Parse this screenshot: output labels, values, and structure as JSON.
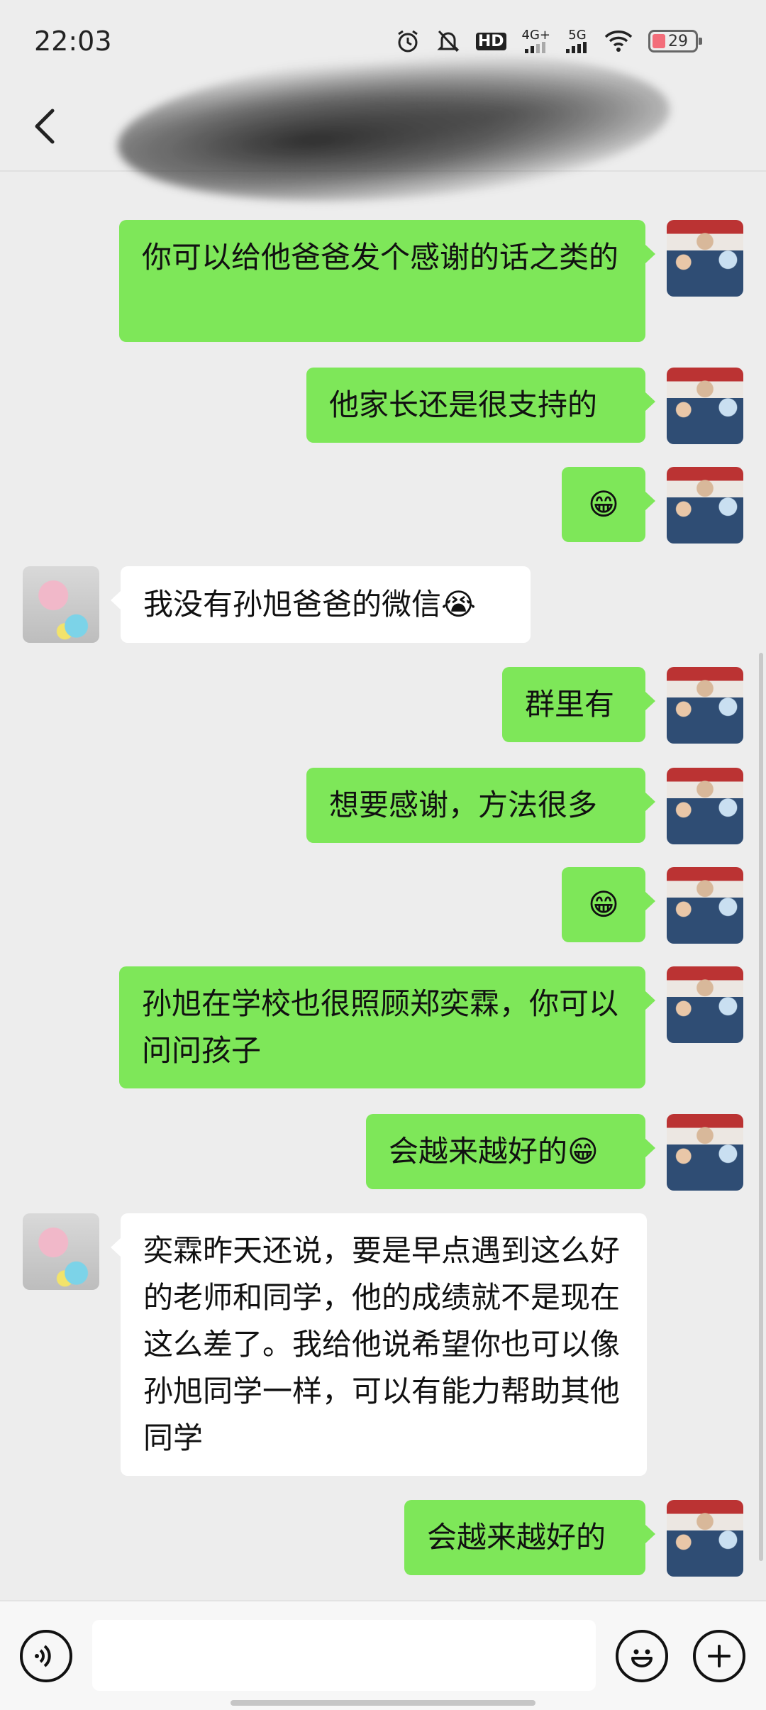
{
  "status_bar": {
    "time": "22:03",
    "network_labels": [
      "4G+",
      "5G"
    ],
    "hd_label": "HD",
    "battery_level": "29"
  },
  "header": {
    "back_icon": "chevron-left-icon",
    "title_redacted": true
  },
  "messages": [
    {
      "side": "out",
      "text": "你可以给他爸爸发个感谢的话之类的"
    },
    {
      "side": "out",
      "text": "他家长还是很支持的"
    },
    {
      "side": "out",
      "text": "😁"
    },
    {
      "side": "in",
      "text": "我没有孙旭爸爸的微信😭"
    },
    {
      "side": "out",
      "text": "群里有"
    },
    {
      "side": "out",
      "text": "想要感谢，方法很多"
    },
    {
      "side": "out",
      "text": "😁"
    },
    {
      "side": "out",
      "text": "孙旭在学校也很照顾郑奕霖，你可以问问孩子"
    },
    {
      "side": "out",
      "text": "会越来越好的😁"
    },
    {
      "side": "in",
      "text": "奕霖昨天还说，要是早点遇到这么好的老师和同学，他的成绩就不是现在这么差了。我给他说希望你也可以像孙旭同学一样，可以有能力帮助其他同学"
    },
    {
      "side": "out",
      "text": "会越来越好的"
    }
  ],
  "input_bar": {
    "voice_icon": "voice-icon",
    "emoji_icon": "emoji-icon",
    "plus_icon": "plus-icon",
    "placeholder": ""
  },
  "colors": {
    "background": "#ededed",
    "outgoing_bubble": "#7ee759",
    "incoming_bubble": "#ffffff"
  }
}
